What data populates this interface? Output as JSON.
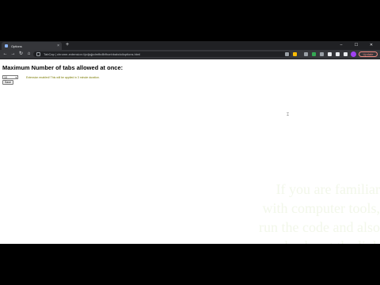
{
  "window": {
    "tab_title": "Options",
    "new_tab_label": "+",
    "minimize": "–",
    "maximize": "☐",
    "close": "✕"
  },
  "toolbar": {
    "back": "←",
    "forward": "→",
    "reload": "↻",
    "home": "⌂",
    "url": "TabCap | chrome-extension://pdjajjcdmfbdlbfhonhbabdoiloptions.html",
    "update_label": "Update"
  },
  "page": {
    "title": "Maximum Number of tabs allowed at once:",
    "select_value": "10",
    "save_label": "Save",
    "status_text": "Extension enabled! This will be applied in 3 minute duration."
  },
  "watermark": {
    "text": "If you are familiar with computer tools, run the code and also check out the link below."
  },
  "colors": {
    "tabbar": "#202124",
    "toolbar": "#35363a",
    "status": "#7a7a00",
    "profile": "#a142f4",
    "update": "#f28b82"
  }
}
